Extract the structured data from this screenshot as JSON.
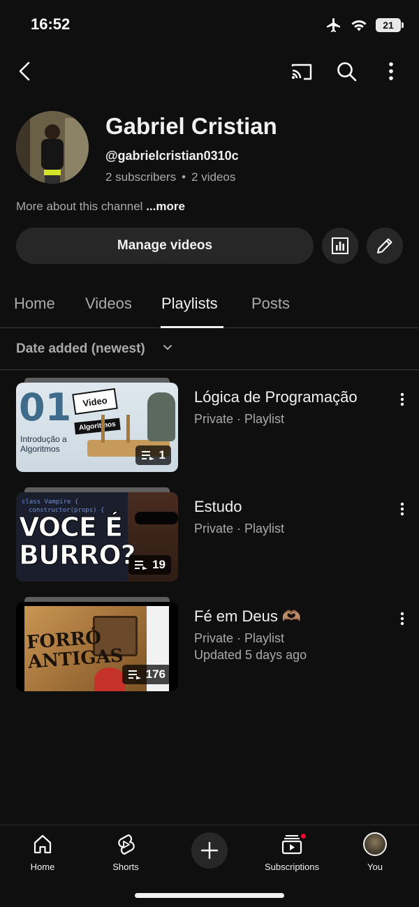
{
  "status_bar": {
    "time": "16:52",
    "battery": "21"
  },
  "channel": {
    "name": "Gabriel Cristian",
    "handle": "@gabrielcristian0310c",
    "subscribers": "2 subscribers",
    "separator": "•",
    "videos": "2 videos",
    "about": "More about this channel",
    "about_more": "...more",
    "manage_label": "Manage videos"
  },
  "tabs": [
    {
      "label": "Home"
    },
    {
      "label": "Videos"
    },
    {
      "label": "Playlists",
      "active": true
    },
    {
      "label": "Posts"
    }
  ],
  "sort": {
    "label": "Date added (newest)"
  },
  "playlists": [
    {
      "title": "Lógica de Programação",
      "subtitle": "Private · Playlist",
      "count": "1",
      "thumb_text": {
        "big": "01",
        "intro": "Introdução a Algoritmos",
        "video_tag": "Video",
        "alg_tag": "Algoritmos"
      }
    },
    {
      "title": "Estudo",
      "subtitle": "Private · Playlist",
      "count": "19",
      "thumb_text": {
        "code": "class Vampire {",
        "code2": "constructor(props) {",
        "line1": "VOCE É",
        "line2": "BURRO?"
      }
    },
    {
      "title": "Fé em Deus 🫶🏽",
      "subtitle": "Private · Playlist",
      "updated": "Updated 5 days ago",
      "count": "176",
      "thumb_text": {
        "forro1": "FORRÓ",
        "forro2": "ANTIGAS"
      }
    }
  ],
  "bottom_nav": {
    "home": "Home",
    "shorts": "Shorts",
    "subscriptions": "Subscriptions",
    "you": "You"
  },
  "colors": {
    "accent_red": "#ff0033",
    "background": "#0f0f0f",
    "chip": "#272727"
  }
}
